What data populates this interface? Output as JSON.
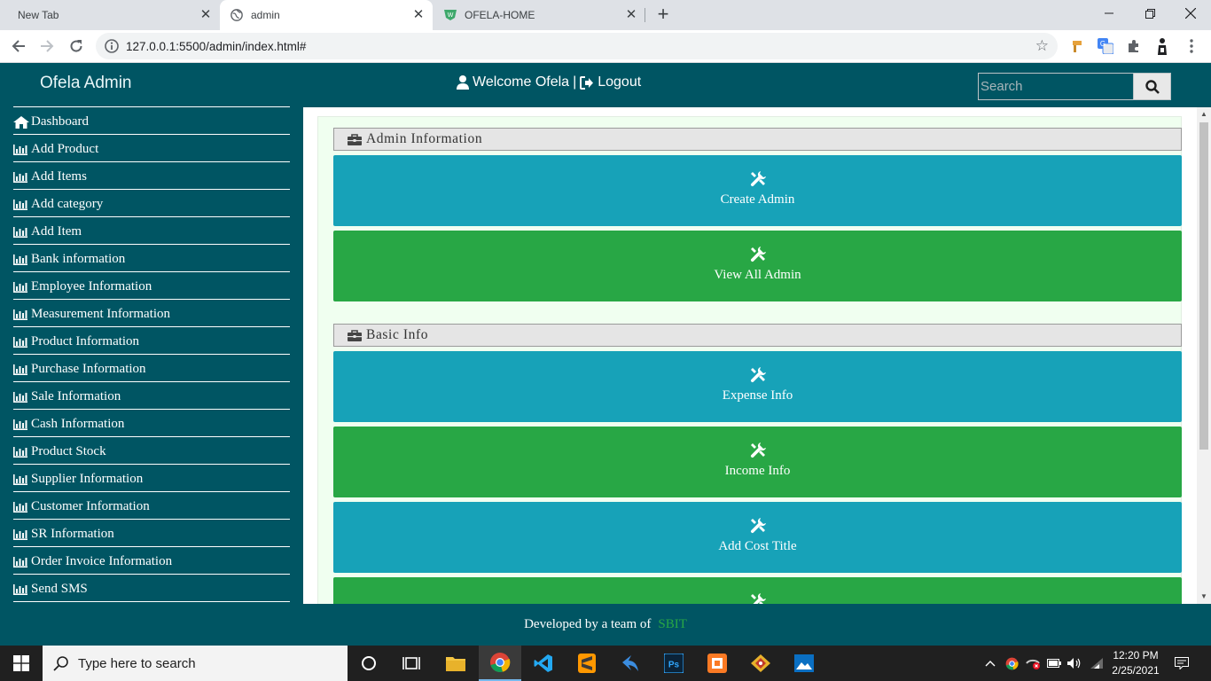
{
  "browser": {
    "tabs": [
      {
        "title": "New Tab"
      },
      {
        "title": "admin"
      },
      {
        "title": "OFELA-HOME"
      }
    ],
    "url": "127.0.0.1:5500/admin/index.html#"
  },
  "header": {
    "brand": "Ofela Admin",
    "welcome": "Welcome Ofela",
    "separator": "|",
    "logout": "Logout",
    "search_placeholder": "Search"
  },
  "sidebar": {
    "items": [
      {
        "label": "Dashboard",
        "icon": "home-icon"
      },
      {
        "label": "Add Product",
        "icon": "bar-chart-icon"
      },
      {
        "label": "Add Items",
        "icon": "bar-chart-icon"
      },
      {
        "label": "Add category",
        "icon": "bar-chart-icon"
      },
      {
        "label": "Add Item",
        "icon": "bar-chart-icon"
      },
      {
        "label": "Bank information",
        "icon": "bar-chart-icon"
      },
      {
        "label": "Employee Information",
        "icon": "bar-chart-icon"
      },
      {
        "label": "Measurement Information",
        "icon": "bar-chart-icon"
      },
      {
        "label": "Product Information",
        "icon": "bar-chart-icon"
      },
      {
        "label": "Purchase Information",
        "icon": "bar-chart-icon"
      },
      {
        "label": "Sale Information",
        "icon": "bar-chart-icon"
      },
      {
        "label": "Cash Information",
        "icon": "bar-chart-icon"
      },
      {
        "label": "Product Stock",
        "icon": "bar-chart-icon"
      },
      {
        "label": "Supplier Information",
        "icon": "bar-chart-icon"
      },
      {
        "label": "Customer Information",
        "icon": "bar-chart-icon"
      },
      {
        "label": "SR Information",
        "icon": "bar-chart-icon"
      },
      {
        "label": "Order Invoice Information",
        "icon": "bar-chart-icon"
      },
      {
        "label": "Send SMS",
        "icon": "bar-chart-icon"
      }
    ]
  },
  "main": {
    "sections": [
      {
        "title": "Admin Information",
        "tiles": [
          {
            "label": "Create Admin",
            "color": "#17a2b8"
          },
          {
            "label": "View All Admin",
            "color": "#28a745"
          }
        ]
      },
      {
        "title": "Basic Info",
        "tiles": [
          {
            "label": "Expense Info",
            "color": "#17a2b8"
          },
          {
            "label": "Income Info",
            "color": "#28a745"
          },
          {
            "label": "Add Cost Title",
            "color": "#17a2b8"
          },
          {
            "label": "",
            "color": "#28a745"
          }
        ]
      }
    ]
  },
  "footer": {
    "text": "Developed by a team of",
    "brand": "SBIT"
  },
  "taskbar": {
    "search_placeholder": "Type here to search",
    "time": "12:20 PM",
    "date": "2/25/2021"
  },
  "colors": {
    "page_bg": "#005563",
    "tile_teal": "#17a2b8",
    "tile_green": "#28a745",
    "panel_bg": "#f0fff0"
  }
}
